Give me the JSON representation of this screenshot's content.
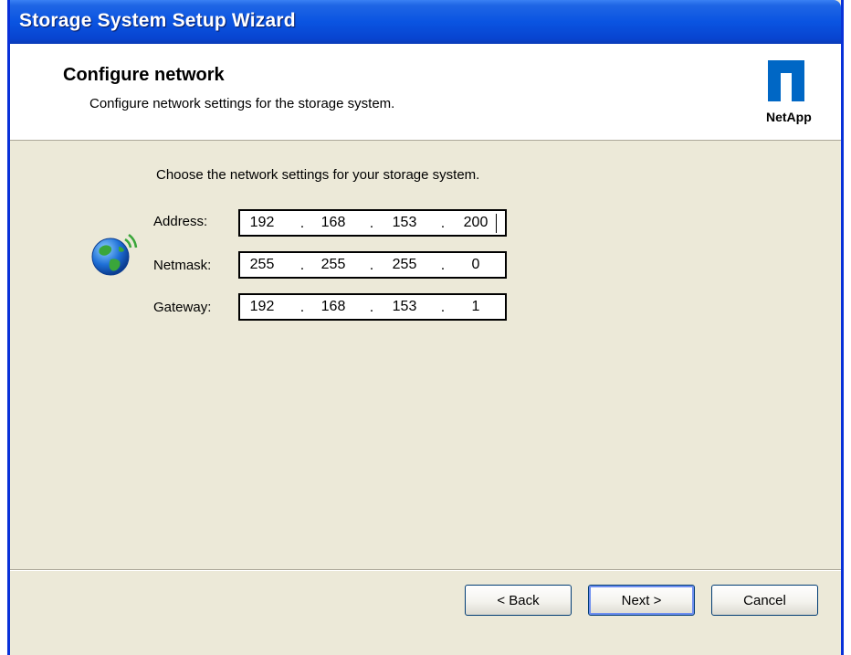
{
  "window": {
    "title": "Storage System Setup Wizard"
  },
  "header": {
    "title": "Configure network",
    "subtitle": "Configure network settings for the storage system.",
    "logo_text": "NetApp"
  },
  "content": {
    "intro": "Choose the network settings for your storage system.",
    "fields": [
      {
        "label": "Address:",
        "octets": [
          "192",
          "168",
          "153",
          "200"
        ],
        "focused": true
      },
      {
        "label": "Netmask:",
        "octets": [
          "255",
          "255",
          "255",
          "0"
        ]
      },
      {
        "label": "Gateway:",
        "octets": [
          "192",
          "168",
          "153",
          "1"
        ]
      }
    ],
    "icon": "network-globe-icon"
  },
  "buttons": {
    "back": "< Back",
    "next": "Next >",
    "cancel": "Cancel"
  },
  "colors": {
    "titlebar": "#0a54e1",
    "dialog_bg": "#ece9d8",
    "logo_blue": "#0067c5"
  }
}
